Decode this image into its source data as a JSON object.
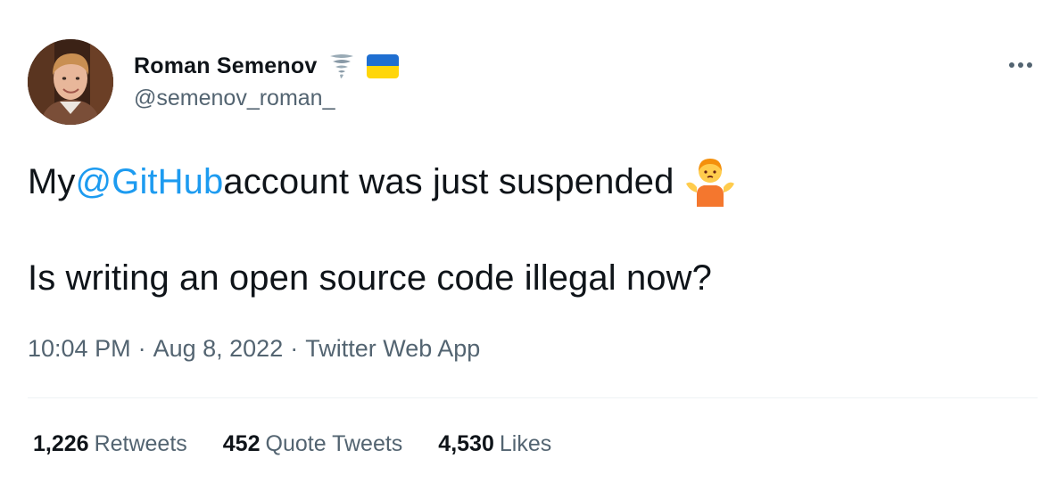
{
  "author": {
    "display_name": "Roman Semenov",
    "handle": "@semenov_roman_",
    "badges": [
      "tornado-emoji",
      "ukraine-flag-emoji"
    ]
  },
  "tweet": {
    "line1_before": "My ",
    "mention": "@GitHub",
    "line1_after": " account was just suspended",
    "line1_emoji": "person-shrugging-emoji",
    "line2": "Is writing an open source code illegal now?"
  },
  "meta": {
    "time": "10:04 PM",
    "separator": "·",
    "date": "Aug 8, 2022",
    "source": "Twitter Web App"
  },
  "stats": {
    "retweets": {
      "count": "1,226",
      "label": "Retweets"
    },
    "quotes": {
      "count": "452",
      "label": "Quote Tweets"
    },
    "likes": {
      "count": "4,530",
      "label": "Likes"
    }
  },
  "colors": {
    "text": "#0f1419",
    "secondary": "#536471",
    "link": "#1d9bf0",
    "divider": "#eff3f4",
    "flag_blue": "#1f6fd1",
    "flag_yellow": "#ffd60a"
  }
}
